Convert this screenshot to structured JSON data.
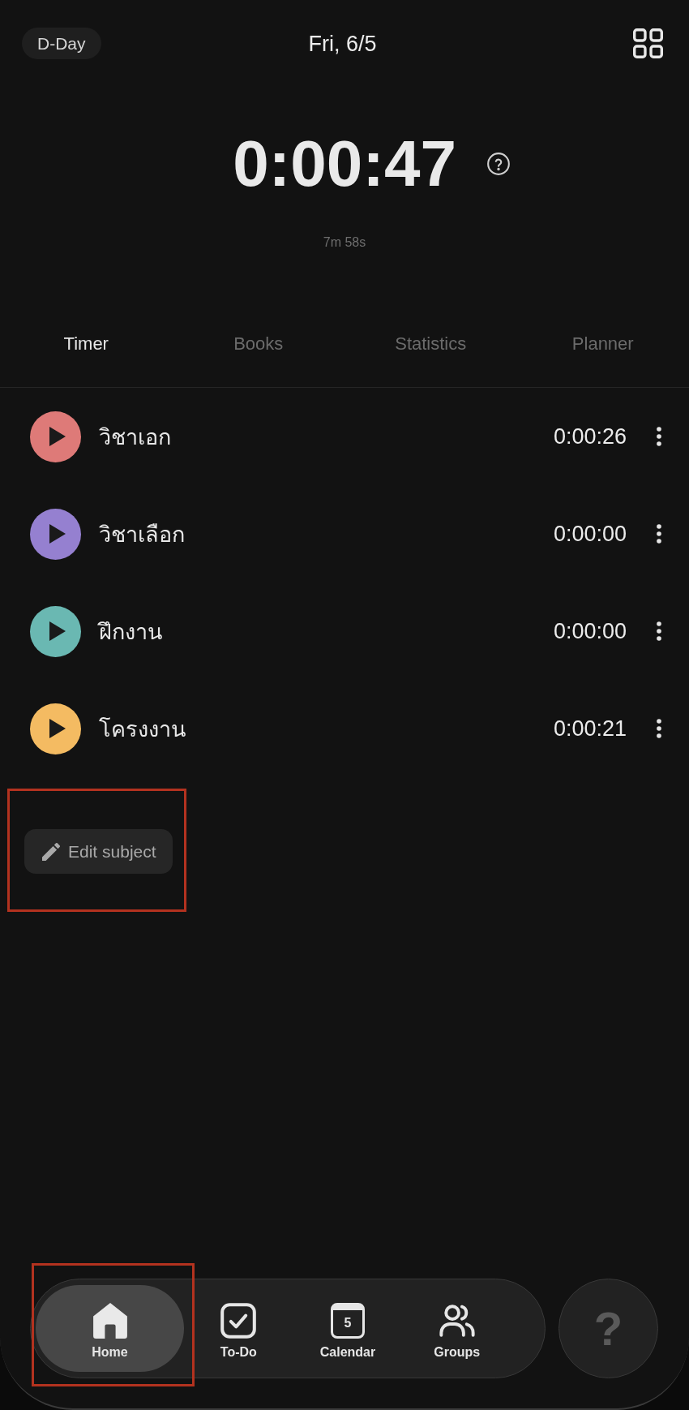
{
  "header": {
    "d_day": "D-Day",
    "date": "Fri, 6/5"
  },
  "timer": {
    "total": "0:00:47",
    "sub_time": "7m 58s"
  },
  "tabs": [
    {
      "label": "Timer",
      "selected": true
    },
    {
      "label": "Books",
      "selected": false
    },
    {
      "label": "Statistics",
      "selected": false
    },
    {
      "label": "Planner",
      "selected": false
    }
  ],
  "subjects": [
    {
      "name": "วิชาเอก",
      "time": "0:00:26",
      "color": "#de7a78"
    },
    {
      "name": "วิชาเลือก",
      "time": "0:00:00",
      "color": "#9580d0"
    },
    {
      "name": "ฝึกงาน",
      "time": "0:00:00",
      "color": "#6ab8b2"
    },
    {
      "name": "โครงงาน",
      "time": "0:00:21",
      "color": "#f4bb62"
    }
  ],
  "edit_button": {
    "label": "Edit subject",
    "highlighted": true
  },
  "nav": {
    "items": [
      {
        "label": "Home",
        "selected": true,
        "highlighted": true
      },
      {
        "label": "To-Do",
        "selected": false,
        "highlighted": false
      },
      {
        "label": "Calendar",
        "selected": false,
        "highlighted": false,
        "icon_text": "5"
      },
      {
        "label": "Groups",
        "selected": false,
        "highlighted": false
      }
    ]
  },
  "help_button": {
    "label": "?"
  }
}
